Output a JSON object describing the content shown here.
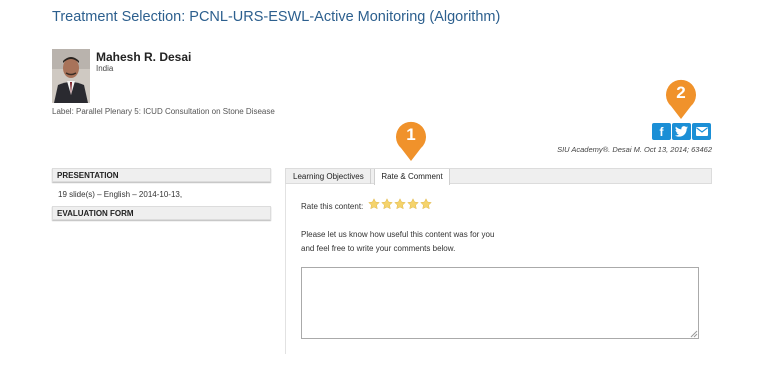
{
  "page": {
    "title": "Treatment Selection: PCNL-URS-ESWL-Active Monitoring (Algorithm)"
  },
  "author": {
    "name": "Mahesh R. Desai",
    "country": "India"
  },
  "label_line": "Label: Parallel Plenary 5: ICUD Consultation on Stone Disease",
  "share": {
    "facebook_glyph": "f",
    "icons": [
      "facebook-icon",
      "twitter-icon",
      "email-icon"
    ],
    "color": "#1b8fd6"
  },
  "citation": "SIU Academy®. Desai M. Oct 13, 2014; 63462",
  "callouts": {
    "one": "1",
    "two": "2",
    "color": "#f0922b"
  },
  "sidebar": {
    "presentation_header": "PRESENTATION",
    "presentation_info": "19 slide(s) – English –  2014-10-13,",
    "evaluation_header": "EVALUATION FORM"
  },
  "tabs": [
    {
      "label": "Learning Objectives"
    },
    {
      "label": "Rate & Comment"
    }
  ],
  "rating": {
    "label": "Rate this content:",
    "stars": 5,
    "star_color": "#f5d36b"
  },
  "comment": {
    "help_line_1": "Please let us know how useful this content was for you",
    "help_line_2": "and feel free to write your comments below.",
    "value": ""
  }
}
